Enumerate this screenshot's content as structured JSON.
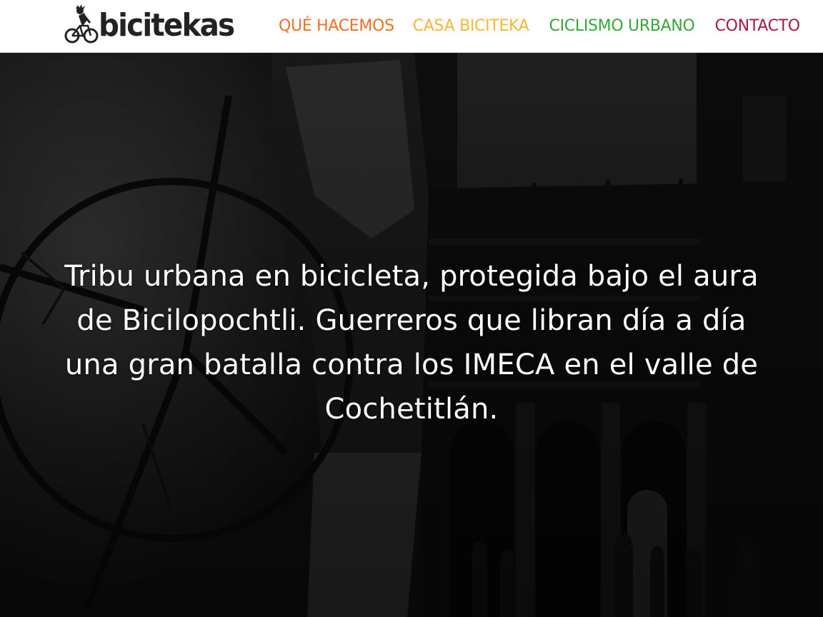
{
  "brand": {
    "logo_text": "bicitekas",
    "logo_icon": "cyclist-icon"
  },
  "nav": {
    "items": [
      {
        "label": "QUÉ HACEMOS",
        "color": "#f36f21"
      },
      {
        "label": "CASA BICITEKA",
        "color": "#f7b731"
      },
      {
        "label": "CICLISMO URBANO",
        "color": "#35a83a"
      },
      {
        "label": "CONTACTO",
        "color": "#a8174b"
      }
    ]
  },
  "hero": {
    "tagline": "Tribu urbana en bicicleta, protegida bajo el aura de Bicilopochtli. Guerreros que libran día a día una gran batalla contra los IMECA en el valle de Cochetitlán.",
    "overlay_color": "#000000"
  }
}
